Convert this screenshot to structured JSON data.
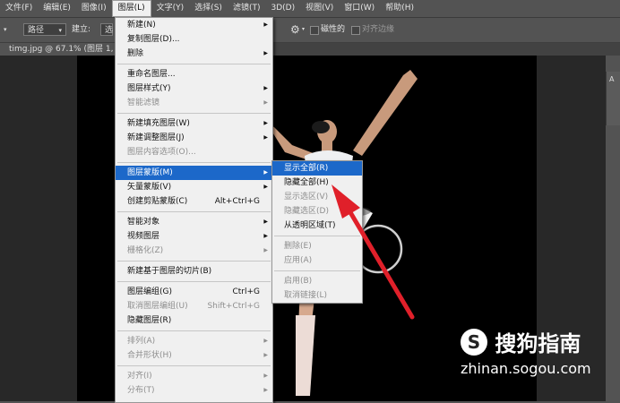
{
  "menubar": {
    "items": [
      "文件(F)",
      "编辑(E)",
      "图像(I)",
      "图层(L)",
      "文字(Y)",
      "选择(S)",
      "滤镜(T)",
      "3D(D)",
      "视图(V)",
      "窗口(W)",
      "帮助(H)"
    ]
  },
  "options": {
    "mode_value": "路径",
    "build_label": "建立:",
    "build_value": "选",
    "magnetic_label": "磁性的",
    "align_edges_label": "对齐边缘"
  },
  "document": {
    "tab_title": "timg.jpg @ 67.1% (图层 1, R"
  },
  "layer_menu": {
    "items": [
      {
        "label": "新建(N)",
        "shortcut": "",
        "sub": true,
        "disabled": false
      },
      {
        "label": "复制图层(D)...",
        "shortcut": "",
        "sub": false,
        "disabled": false
      },
      {
        "label": "删除",
        "shortcut": "",
        "sub": true,
        "disabled": false
      },
      {
        "sep": true
      },
      {
        "label": "重命名图层...",
        "shortcut": "",
        "sub": false,
        "disabled": false
      },
      {
        "label": "图层样式(Y)",
        "shortcut": "",
        "sub": true,
        "disabled": false
      },
      {
        "label": "智能滤镜",
        "shortcut": "",
        "sub": true,
        "disabled": true
      },
      {
        "sep": true
      },
      {
        "label": "新建填充图层(W)",
        "shortcut": "",
        "sub": true,
        "disabled": false
      },
      {
        "label": "新建调整图层(J)",
        "shortcut": "",
        "sub": true,
        "disabled": false
      },
      {
        "label": "图层内容选项(O)...",
        "shortcut": "",
        "sub": false,
        "disabled": true
      },
      {
        "sep": true
      },
      {
        "label": "图层蒙版(M)",
        "shortcut": "",
        "sub": true,
        "disabled": false,
        "highlight": true
      },
      {
        "label": "矢量蒙版(V)",
        "shortcut": "",
        "sub": true,
        "disabled": false
      },
      {
        "label": "创建剪贴蒙版(C)",
        "shortcut": "Alt+Ctrl+G",
        "sub": false,
        "disabled": false
      },
      {
        "sep": true
      },
      {
        "label": "智能对象",
        "shortcut": "",
        "sub": true,
        "disabled": false
      },
      {
        "label": "视频图层",
        "shortcut": "",
        "sub": true,
        "disabled": false
      },
      {
        "label": "栅格化(Z)",
        "shortcut": "",
        "sub": true,
        "disabled": true
      },
      {
        "sep": true
      },
      {
        "label": "新建基于图层的切片(B)",
        "shortcut": "",
        "sub": false,
        "disabled": false
      },
      {
        "sep": true
      },
      {
        "label": "图层编组(G)",
        "shortcut": "Ctrl+G",
        "sub": false,
        "disabled": false
      },
      {
        "label": "取消图层编组(U)",
        "shortcut": "Shift+Ctrl+G",
        "sub": false,
        "disabled": true
      },
      {
        "label": "隐藏图层(R)",
        "shortcut": "",
        "sub": false,
        "disabled": false
      },
      {
        "sep": true
      },
      {
        "label": "排列(A)",
        "shortcut": "",
        "sub": true,
        "disabled": true
      },
      {
        "label": "合并形状(H)",
        "shortcut": "",
        "sub": true,
        "disabled": true
      },
      {
        "sep": true
      },
      {
        "label": "对齐(I)",
        "shortcut": "",
        "sub": true,
        "disabled": true
      },
      {
        "label": "分布(T)",
        "shortcut": "",
        "sub": true,
        "disabled": true
      }
    ]
  },
  "mask_submenu": {
    "items": [
      {
        "label": "显示全部(R)",
        "disabled": false,
        "highlight": true
      },
      {
        "label": "隐藏全部(H)",
        "disabled": false
      },
      {
        "label": "显示选区(V)",
        "disabled": true
      },
      {
        "label": "隐藏选区(D)",
        "disabled": true
      },
      {
        "label": "从透明区域(T)",
        "disabled": false
      },
      {
        "sep": true
      },
      {
        "label": "删除(E)",
        "disabled": true
      },
      {
        "label": "应用(A)",
        "disabled": true
      },
      {
        "sep": true
      },
      {
        "label": "启用(B)",
        "disabled": true
      },
      {
        "label": "取消链接(L)",
        "disabled": true
      }
    ]
  },
  "watermark": {
    "brand": "搜狗指南",
    "url": "zhinan.sogou.com"
  },
  "colors": {
    "menu_highlight": "#1c68c9",
    "arrow": "#e0202a",
    "chrome": "#535353"
  }
}
